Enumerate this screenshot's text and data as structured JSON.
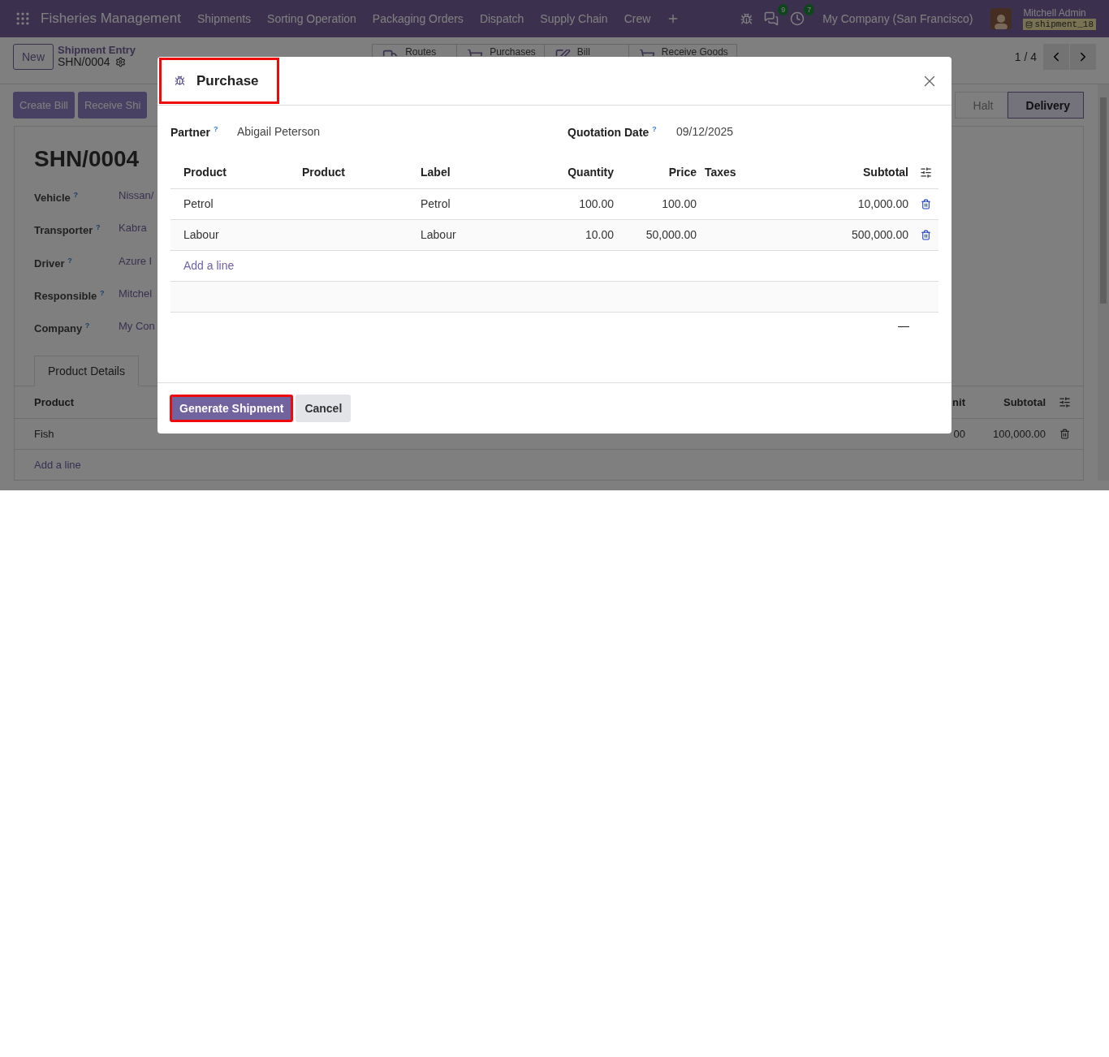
{
  "navbar": {
    "app_name": "Fisheries Management",
    "menu": [
      "Shipments",
      "Sorting Operation",
      "Packaging Orders",
      "Dispatch",
      "Supply Chain",
      "Crew"
    ],
    "badges": [
      {
        "kind": "chat",
        "count": "9"
      },
      {
        "kind": "activity",
        "count": "7"
      }
    ],
    "company": "My Company (San Francisco)",
    "user": {
      "name": "Mitchell Admin",
      "database": "shipment_18"
    }
  },
  "control_panel": {
    "new_button": "New",
    "breadcrumb": {
      "parent": "Shipment Entry",
      "current": "SHN/0004"
    },
    "smart_buttons": [
      {
        "kind": "truck",
        "label": "Routes"
      },
      {
        "kind": "cart",
        "label": "Purchases"
      },
      {
        "kind": "edit",
        "label": "Bill"
      },
      {
        "kind": "cart",
        "label": "Receive Goods"
      }
    ],
    "pager": "1 / 4"
  },
  "action_buttons": [
    "Create Bill",
    "Receive Shi"
  ],
  "stages": [
    {
      "label": "Halt",
      "selected": false
    },
    {
      "label": "Delivery",
      "selected": true
    }
  ],
  "record": {
    "title": "SHN/0004",
    "fields": [
      {
        "label": "Vehicle",
        "help": "?",
        "value": "Nissan/"
      },
      {
        "label": "Transporter",
        "help": "?",
        "value": "Kabra"
      },
      {
        "label": "Driver",
        "help": "?",
        "value": "Azure I"
      },
      {
        "label": "Responsible",
        "help": "?",
        "value": "Mitchel"
      },
      {
        "label": "Company",
        "help": "?",
        "value": "My Con"
      }
    ],
    "tabs": [
      {
        "label": "Product Details",
        "selected": true
      }
    ],
    "lines_table": {
      "columns": [
        "Product",
        "nit",
        "Subtotal"
      ],
      "rows": [
        {
          "cells": [
            "Fish",
            "00",
            "100,000.00"
          ]
        }
      ],
      "add_line": "Add a line"
    }
  },
  "dialog": {
    "title": "Purchase",
    "title_highlighted": true,
    "partner": {
      "label": "Partner",
      "help": "?",
      "value": "Abigail Peterson"
    },
    "quotation_date": {
      "label": "Quotation Date",
      "help": "?",
      "value": "09/12/2025"
    },
    "table": {
      "columns": [
        "Product",
        "Product",
        "Label",
        "Quantity",
        "Price",
        "Taxes",
        "Subtotal"
      ],
      "rows": [
        {
          "cells": [
            "Petrol",
            "",
            "Petrol",
            "100.00",
            "100.00",
            "",
            "10,000.00"
          ]
        },
        {
          "cells": [
            "Labour",
            "",
            "Labour",
            "10.00",
            "50,000.00",
            "",
            "500,000.00"
          ]
        }
      ],
      "add_line": "Add a line",
      "total": "—"
    },
    "buttons": [
      {
        "label": "Generate Shipment",
        "kind": "primary",
        "highlighted": true
      },
      {
        "label": "Cancel",
        "kind": "secondary",
        "highlighted": false
      }
    ]
  }
}
